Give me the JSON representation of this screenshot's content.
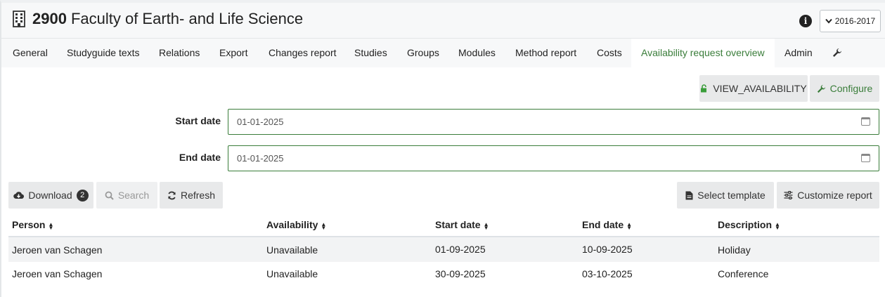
{
  "header": {
    "code": "2900",
    "name": "Faculty of Earth- and Life Science",
    "info_icon": "i",
    "year": "2016-2017"
  },
  "tabs": [
    {
      "label": "General"
    },
    {
      "label": "Studyguide texts"
    },
    {
      "label": "Relations"
    },
    {
      "label": "Export"
    },
    {
      "label": "Changes report"
    },
    {
      "label": "Studies"
    },
    {
      "label": "Groups"
    },
    {
      "label": "Modules"
    },
    {
      "label": "Method report"
    },
    {
      "label": "Costs"
    },
    {
      "label": "Availability request overview"
    },
    {
      "label": "Admin"
    }
  ],
  "actions": {
    "view_availability": "VIEW_AVAILABILITY",
    "configure": "Configure"
  },
  "form": {
    "start_label": "Start date",
    "start_value": "01-01-2025",
    "end_label": "End date",
    "end_value": "01-01-2025"
  },
  "toolbar": {
    "download": "Download",
    "download_count": "2",
    "search": "Search",
    "refresh": "Refresh",
    "select_template": "Select template",
    "customize_report": "Customize report"
  },
  "table": {
    "headers": [
      "Person",
      "Availability",
      "Start date",
      "End date",
      "Description"
    ],
    "rows": [
      [
        "Jeroen van Schagen",
        "Unavailable",
        "01-09-2025",
        "10-09-2025",
        "Holiday"
      ],
      [
        "Jeroen van Schagen",
        "Unavailable",
        "30-09-2025",
        "03-10-2025",
        "Conference"
      ]
    ]
  },
  "colors": {
    "accent": "#3a7d3a"
  }
}
